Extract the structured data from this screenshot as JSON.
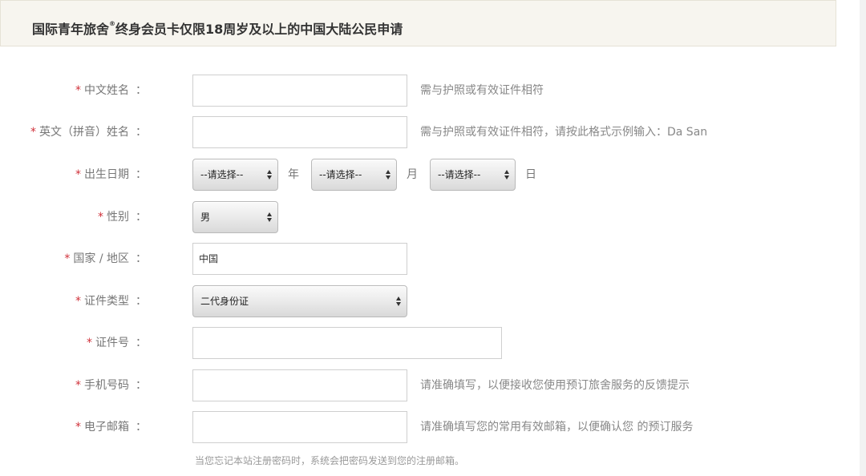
{
  "header": {
    "title_before_mark": "国际青年旅舍",
    "reg_mark": "®",
    "title_after_mark": "终身会员卡仅限18周岁及以上的中国大陆公民申请"
  },
  "form": {
    "required_mark": "*",
    "colon": "：",
    "chinese_name": {
      "label": "中文姓名",
      "value": "",
      "hint": "需与护照或有效证件相符"
    },
    "english_name": {
      "label": "英文（拼音）姓名",
      "value": "",
      "hint": "需与护照或有效证件相符，请按此格式示例输入：Da San"
    },
    "birth_date": {
      "label": "出生日期",
      "year_select": "--请选择--",
      "year_unit": "年",
      "month_select": "--请选择--",
      "month_unit": "月",
      "day_select": "--请选择--",
      "day_unit": "日"
    },
    "gender": {
      "label": "性别",
      "selected": "男"
    },
    "country": {
      "label": "国家 / 地区",
      "value": "中国"
    },
    "id_type": {
      "label": "证件类型",
      "selected": "二代身份证"
    },
    "id_number": {
      "label": "证件号",
      "value": ""
    },
    "mobile": {
      "label": "手机号码",
      "value": "",
      "hint": "请准确填写，以便接收您使用预订旅舍服务的反馈提示"
    },
    "email": {
      "label": "电子邮箱",
      "value": "",
      "hint": "请准确填写您的常用有效邮箱，以便确认您 的预订服务",
      "note": "当您忘记本站注册密码时，系统会把密码发送到您的注册邮箱。"
    }
  }
}
